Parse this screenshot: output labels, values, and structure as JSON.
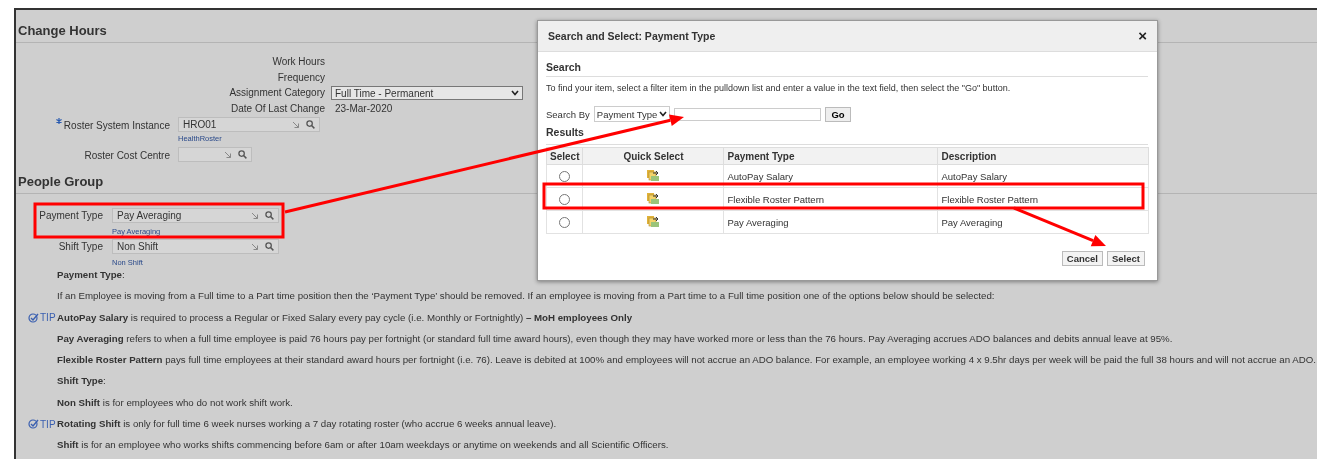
{
  "page": {
    "title": "Change Hours"
  },
  "hours_fields": [
    {
      "label": "Work Hours",
      "kind": "label"
    },
    {
      "label": "Frequency",
      "kind": "label"
    },
    {
      "label": "Assignment Category",
      "kind": "select",
      "value": "Full Time - Permanent"
    },
    {
      "label": "Date Of Last Change",
      "kind": "text",
      "value": "23-Mar-2020"
    }
  ],
  "roster_fields": [
    {
      "label": "Roster System Instance",
      "required": true,
      "value": "HRO01",
      "hint": "HealthRoster"
    },
    {
      "label": "Roster Cost Centre",
      "required": false
    }
  ],
  "people_group": {
    "title": "People Group",
    "fields": [
      {
        "label": "Payment Type",
        "value": "Pay Averaging",
        "hint": "Pay Averaging"
      },
      {
        "label": "Shift Type",
        "value": "Non Shift",
        "hint": "Non Shift"
      }
    ]
  },
  "notes": [
    {
      "text": "**Payment Type**:"
    },
    {
      "text": "If an Employee is moving from a Full time to a Part time position then the ‘Payment Type’ should be removed. If an employee is moving from a Part time to a Full time position one of the options below should be selected:"
    },
    {
      "tip": "TIP",
      "text": "**AutoPay Salary** is required to process a Regular or Fixed Salary every pay cycle (i.e. Monthly or Fortnightly) **– MoH employees Only**"
    },
    {
      "text": "**Pay Averaging** refers to when a full time employee is paid 76 hours pay per fortnight (or standard full time award hours), even though they may have worked more or less than the 76 hours. Pay Averaging accrues ADO balances and debits annual leave at 95%."
    },
    {
      "text": "**Flexible Roster Pattern** pays full time employees at their standard award hours per fortnight (i.e. 76). Leave is debited at 100% and employees will not accrue an ADO balance. For example, an employee working 4 x 9.5hr days per week will be paid the full 38 hours and will not accrue an ADO."
    },
    {
      "text": "**Shift Type**:"
    },
    {
      "text": "**Non Shift** is for employees who do not work shift work."
    },
    {
      "tip": "TIP",
      "text": "**Rotating Shift** is only for full time 6 week nurses working a 7 day rotating roster (who accrue 6 weeks annual leave)."
    },
    {
      "text": "**Shift** is for an employee who works shifts commencing before 6am or after 10am weekdays or anytime on weekends and all Scientific Officers."
    }
  ],
  "dialog": {
    "title": "Search and Select: Payment Type",
    "close": "×",
    "section": "Search",
    "instructions": "To find your item, select a filter item in the pulldown list and enter a value in the text field, then select the \"Go\" button.",
    "search_by_label": "Search By",
    "search_by": "Payment Type",
    "go": "Go",
    "results_title": "Results",
    "columns": [
      "Select",
      "Quick Select",
      "Payment Type",
      "Description"
    ],
    "rows": [
      {
        "payment_type": "AutoPay Salary",
        "description": "AutoPay Salary",
        "selected": false
      },
      {
        "payment_type": "Flexible Roster Pattern",
        "description": "Flexible Roster Pattern",
        "selected": false
      },
      {
        "payment_type": "Pay Averaging",
        "description": "Pay Averaging",
        "selected": false
      }
    ],
    "buttons": [
      "Cancel",
      "Select"
    ]
  }
}
